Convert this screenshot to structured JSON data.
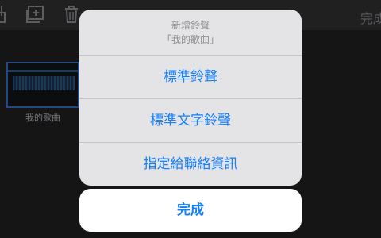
{
  "toolbar": {
    "icons": [
      "share-icon",
      "add-icon",
      "trash-icon"
    ],
    "done_label": "完成"
  },
  "library": {
    "song_name": "我的歌曲"
  },
  "action_sheet": {
    "title": "新增鈴聲",
    "message": "「我的歌曲」",
    "options": [
      "標準鈴聲",
      "標準文字鈴聲",
      "指定給聯絡資訊"
    ],
    "cancel_label": "完成"
  },
  "colors": {
    "accent": "#147efb",
    "sheet_bg": "#e4e4e6",
    "backdrop": "#1c1c1e"
  }
}
